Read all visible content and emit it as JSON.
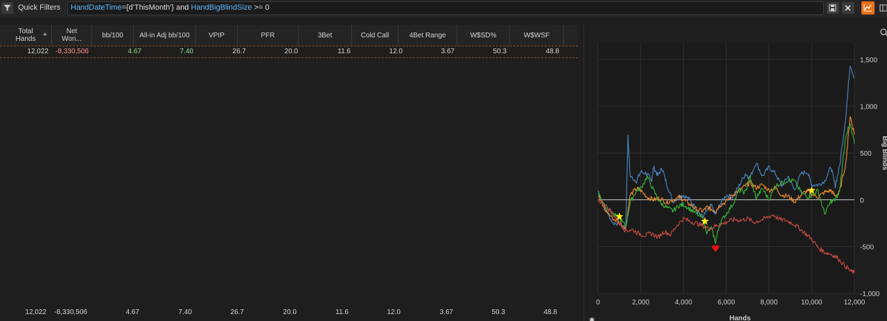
{
  "toolbar": {
    "quick_filters_label": "Quick Filters",
    "filter_tokens": [
      {
        "text": "HandDateTime",
        "kind": "field"
      },
      {
        "text": "={d'ThisMonth'} and ",
        "kind": "plain"
      },
      {
        "text": "HandBigBlindSize",
        "kind": "field"
      },
      {
        "text": " >= 0",
        "kind": "plain"
      }
    ],
    "buttons": [
      "save-icon",
      "clear-icon",
      "graph-icon",
      "layout-icon"
    ],
    "colors": {
      "graph_active": "#e8701a"
    }
  },
  "table": {
    "columns": [
      "Total Hands",
      "Net Won...",
      "bb/100",
      "All-in Adj bb/100",
      "VPIP",
      "PFR",
      "3Bet",
      "Cold Call",
      "4Bet Range",
      "W$SD%",
      "W$WSF"
    ],
    "row": [
      "12,022",
      "-8,330,506",
      "4.67",
      "7.40",
      "26.7",
      "20.0",
      "11.6",
      "12.0",
      "3.67",
      "50.3",
      "48.8"
    ],
    "footer": [
      "12,022",
      "-8,330,506",
      "4.67",
      "7.40",
      "26.7",
      "20.0",
      "11.6",
      "12.0",
      "3.67",
      "50.3",
      "48.8"
    ]
  },
  "chart_data": {
    "type": "line",
    "xlabel": "Hands",
    "ylabel": "Big Blinds",
    "xlim": [
      0,
      12000
    ],
    "ylim": [
      -1000,
      1500
    ],
    "xticks": [
      0,
      2000,
      4000,
      6000,
      8000,
      10000,
      12000
    ],
    "xtick_labels": [
      "0",
      "2,000",
      "4,000",
      "6,000",
      "8,000",
      "10,000",
      "12,000"
    ],
    "yticks": [
      -1000,
      -500,
      0,
      500,
      1000,
      1500
    ],
    "ytick_labels": [
      "-1,000",
      "-500",
      "0",
      "500",
      "1,000",
      "1,500"
    ],
    "grid": true,
    "series": [
      {
        "color": "#4a82c0",
        "x": [
          0,
          300,
          700,
          1000,
          1300,
          1400,
          1500,
          1800,
          2000,
          2300,
          2500,
          2600,
          2800,
          3000,
          3200,
          3500,
          3800,
          4000,
          4300,
          4600,
          4900,
          5100,
          5300,
          5500,
          5700,
          6000,
          6300,
          6600,
          6900,
          7100,
          7400,
          7700,
          8000,
          8300,
          8600,
          8900,
          9200,
          9500,
          9800,
          10000,
          10300,
          10600,
          10900,
          11100,
          11300,
          11600,
          11800,
          12000
        ],
        "y": [
          100,
          -80,
          -250,
          -250,
          -300,
          700,
          250,
          200,
          300,
          280,
          200,
          350,
          260,
          340,
          180,
          -20,
          30,
          50,
          0,
          -100,
          -180,
          -120,
          -60,
          -160,
          -50,
          50,
          30,
          150,
          280,
          230,
          400,
          250,
          350,
          280,
          150,
          250,
          100,
          280,
          300,
          160,
          160,
          200,
          350,
          150,
          350,
          900,
          1450,
          1300
        ]
      },
      {
        "color": "#e8892f",
        "x": [
          0,
          300,
          700,
          1000,
          1300,
          1500,
          1800,
          2000,
          2300,
          2600,
          2900,
          3200,
          3500,
          3800,
          4000,
          4300,
          4600,
          4900,
          5100,
          5300,
          5500,
          5700,
          6000,
          6300,
          6600,
          6900,
          7100,
          7400,
          7700,
          8000,
          8300,
          8600,
          8900,
          9200,
          9500,
          9800,
          10000,
          10300,
          10600,
          10900,
          11100,
          11300,
          11600,
          11800,
          12000
        ],
        "y": [
          50,
          -100,
          -200,
          -250,
          -300,
          50,
          120,
          100,
          30,
          0,
          20,
          -30,
          0,
          30,
          0,
          -50,
          -100,
          -120,
          -80,
          -100,
          -120,
          -60,
          -20,
          50,
          100,
          150,
          180,
          130,
          160,
          100,
          130,
          50,
          40,
          -20,
          50,
          100,
          60,
          30,
          80,
          100,
          40,
          80,
          400,
          900,
          700
        ]
      },
      {
        "color": "#38b038",
        "x": [
          0,
          300,
          700,
          1000,
          1300,
          1500,
          1800,
          2000,
          2300,
          2600,
          2900,
          3200,
          3500,
          3800,
          4000,
          4300,
          4600,
          4900,
          5100,
          5300,
          5500,
          5700,
          6000,
          6300,
          6600,
          6900,
          7100,
          7400,
          7700,
          8000,
          8300,
          8600,
          8900,
          9200,
          9500,
          9800,
          10000,
          10300,
          10600,
          10900,
          11100,
          11300,
          11600,
          11800,
          12000
        ],
        "y": [
          80,
          -50,
          -150,
          -200,
          -280,
          -30,
          100,
          120,
          250,
          100,
          -30,
          -80,
          -120,
          -60,
          -50,
          -100,
          -150,
          -200,
          -350,
          -300,
          -450,
          -250,
          -150,
          -50,
          100,
          80,
          250,
          20,
          120,
          0,
          150,
          180,
          210,
          200,
          80,
          30,
          50,
          100,
          -150,
          -20,
          0,
          80,
          700,
          800,
          600
        ]
      },
      {
        "color": "#c24a40",
        "x": [
          0,
          300,
          700,
          1000,
          1300,
          1600,
          1900,
          2200,
          2500,
          2800,
          3100,
          3400,
          3700,
          4000,
          4300,
          4600,
          4900,
          5200,
          5500,
          5800,
          6100,
          6400,
          6700,
          7000,
          7300,
          7600,
          7900,
          8200,
          8500,
          8800,
          9100,
          9400,
          9700,
          10000,
          10300,
          10600,
          10900,
          11200,
          11500,
          11800,
          12000
        ],
        "y": [
          0,
          -50,
          -150,
          -250,
          -330,
          -320,
          -360,
          -380,
          -360,
          -400,
          -340,
          -370,
          -270,
          -200,
          -230,
          -250,
          -280,
          -310,
          -280,
          -260,
          -230,
          -210,
          -220,
          -200,
          -240,
          -220,
          -190,
          -160,
          -210,
          -220,
          -250,
          -300,
          -360,
          -420,
          -510,
          -560,
          -580,
          -620,
          -690,
          -760,
          -780
        ]
      }
    ],
    "markers": [
      {
        "kind": "star",
        "x": 1000,
        "y": -180,
        "color": "#ffee22"
      },
      {
        "kind": "star",
        "x": 5000,
        "y": -230,
        "color": "#ffee22"
      },
      {
        "kind": "star",
        "x": 10000,
        "y": 100,
        "color": "#ffee22"
      },
      {
        "kind": "heart",
        "x": 5500,
        "y": -520,
        "color": "#ee1111"
      }
    ]
  }
}
